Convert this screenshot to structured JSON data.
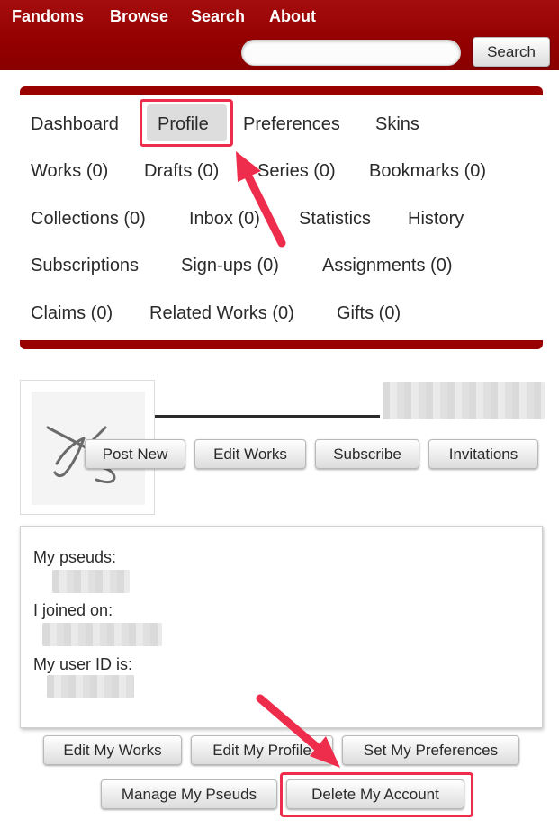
{
  "header": {
    "nav": [
      "Fandoms",
      "Browse",
      "Search",
      "About"
    ],
    "search_placeholder": "",
    "search_button": "Search"
  },
  "dashboard": {
    "links": {
      "dashboard": "Dashboard",
      "profile": "Profile",
      "preferences": "Preferences",
      "skins": "Skins",
      "works": "Works (0)",
      "drafts": "Drafts (0)",
      "series": "Series (0)",
      "bookmarks": "Bookmarks (0)",
      "collections": "Collections (0)",
      "inbox": "Inbox (0)",
      "statistics": "Statistics",
      "history": "History",
      "subscriptions": "Subscriptions",
      "signups": "Sign-ups (0)",
      "assignments": "Assignments (0)",
      "claims": "Claims (0)",
      "related_works": "Related Works (0)",
      "gifts": "Gifts (0)"
    },
    "selected": "Profile"
  },
  "profile": {
    "actions": [
      "Post New",
      "Edit Works",
      "Subscribe",
      "Invitations"
    ]
  },
  "user_info": {
    "pseuds_label": "My pseuds:",
    "joined_label": "I joined on:",
    "user_id_label": "My user ID is:"
  },
  "footer_actions": {
    "edit_my_works": "Edit My Works",
    "edit_my_profile": "Edit My Profile",
    "set_my_preferences": "Set My Preferences",
    "manage_my_pseuds": "Manage My Pseuds",
    "delete_my_account": "Delete My Account"
  },
  "colors": {
    "header": "#990000",
    "annotation": "#ee2c4c"
  }
}
